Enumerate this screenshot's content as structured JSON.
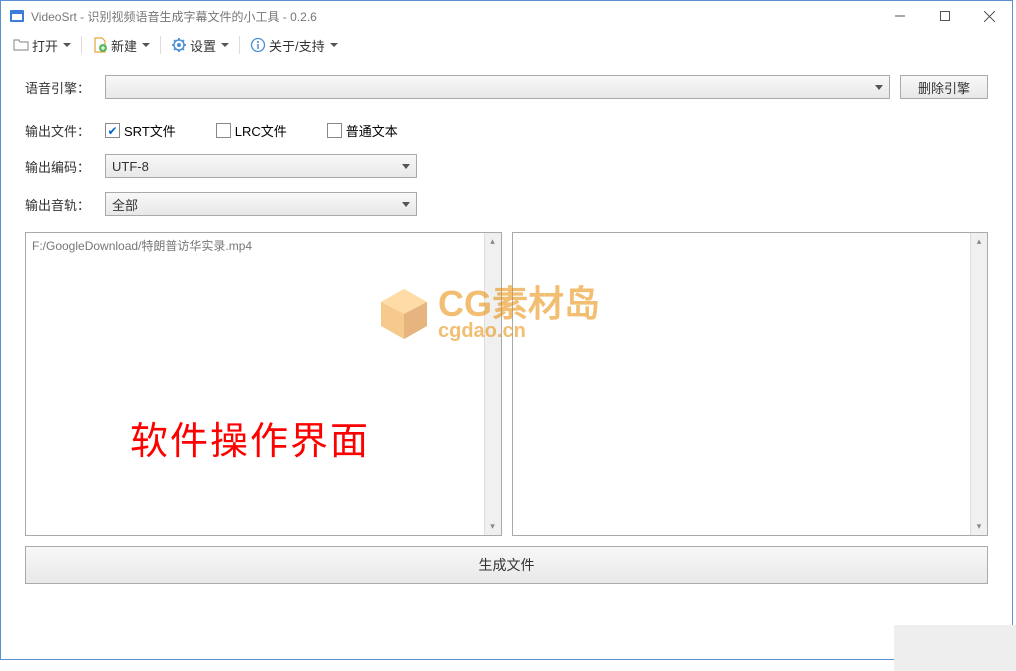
{
  "window": {
    "title": "VideoSrt - 识别视频语音生成字幕文件的小工具 - 0.2.6"
  },
  "toolbar": {
    "open": "打开",
    "new": "新建",
    "settings": "设置",
    "about": "关于/支持"
  },
  "form": {
    "engine_label": "语音引擎：",
    "engine_value": "",
    "delete_engine": "删除引擎",
    "output_file_label": "输出文件：",
    "srt_label": "SRT文件",
    "lrc_label": "LRC文件",
    "txt_label": "普通文本",
    "encoding_label": "输出编码：",
    "encoding_value": "UTF-8",
    "track_label": "输出音轨：",
    "track_value": "全部"
  },
  "panel": {
    "file_path": "F:/GoogleDownload/特朗普访华实录.mp4"
  },
  "generate": "生成文件",
  "watermark": {
    "main": "CG素材岛",
    "sub": "cgdao.cn"
  },
  "overlay": "软件操作界面"
}
